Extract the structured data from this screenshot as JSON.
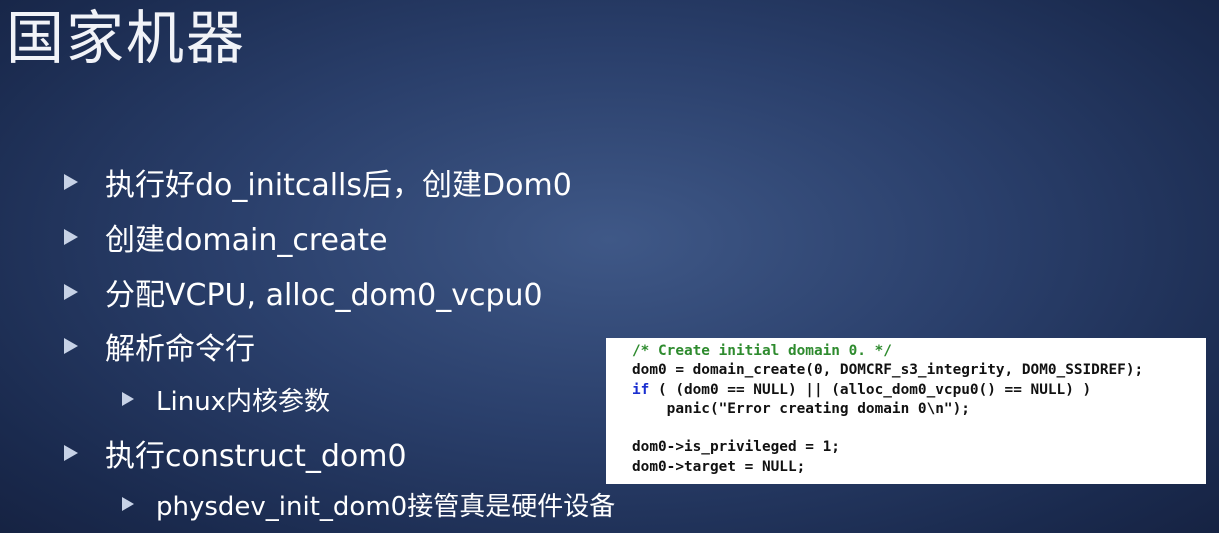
{
  "slide": {
    "title": "国家机器",
    "bullets": [
      {
        "text": "执行好do_initcalls后，创建Dom0",
        "level": 1
      },
      {
        "text": "创建domain_create",
        "level": 1
      },
      {
        "text": "分配VCPU, alloc_dom0_vcpu0",
        "level": 1
      },
      {
        "text": "解析命令行",
        "level": 1
      },
      {
        "text": "Linux内核参数",
        "level": 2
      },
      {
        "text": "执行construct_dom0",
        "level": 1
      },
      {
        "text": "physdev_init_dom0接管真是硬件设备",
        "level": 2
      }
    ],
    "code": {
      "comment": "/* Create initial domain 0. */",
      "line2": "dom0 = domain_create(0, DOMCRF_s3_integrity, DOM0_SSIDREF);",
      "if_keyword": "if",
      "line3_rest": " ( (dom0 == NULL) || (alloc_dom0_vcpu0() == NULL) )",
      "line4": "    panic(\"Error creating domain 0\\n\");",
      "line5": "",
      "line6": "dom0->is_privileged = 1;",
      "line7": "dom0->target = NULL;"
    }
  },
  "colors": {
    "background_center": "#3f5887",
    "background_edge": "#141f3d",
    "bullet_arrow": "#c7d2e6",
    "code_comment": "#2e8b2e",
    "code_keyword": "#1a2fd0"
  }
}
